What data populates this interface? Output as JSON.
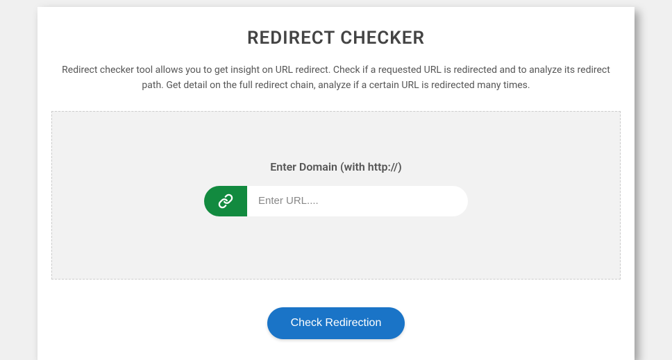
{
  "header": {
    "title": "REDIRECT CHECKER",
    "description": "Redirect checker tool allows you to get insight on URL redirect. Check if a requested URL is redirected and to analyze its redirect path. Get detail on the full redirect chain, analyze if a certain URL is redirected many times."
  },
  "form": {
    "label": "Enter Domain (with http://)",
    "placeholder": "Enter URL....",
    "value": ""
  },
  "actions": {
    "submit_label": "Check Redirection"
  },
  "icons": {
    "link": "link-icon"
  },
  "colors": {
    "icon_bg": "#128a3f",
    "button_bg": "#1a74c7",
    "panel_bg": "#f2f2f2"
  }
}
